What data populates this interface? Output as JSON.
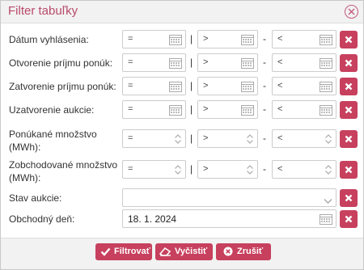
{
  "dialog": {
    "title": "Filter tabuľky",
    "close_icon": "close-circle-icon"
  },
  "rows": [
    {
      "label": "Dátum vyhlásenia:",
      "kind": "date-range",
      "op_eq": "=",
      "op_gt": ">",
      "op_lt": "<"
    },
    {
      "label": "Otvorenie príjmu ponúk:",
      "kind": "date-range",
      "op_eq": "=",
      "op_gt": ">",
      "op_lt": "<"
    },
    {
      "label": "Zatvorenie príjmu ponúk:",
      "kind": "date-range",
      "op_eq": "=",
      "op_gt": ">",
      "op_lt": "<"
    },
    {
      "label": "Uzatvorenie aukcie:",
      "kind": "date-range",
      "op_eq": "=",
      "op_gt": ">",
      "op_lt": "<"
    },
    {
      "label_line1": "Ponúkané množstvo",
      "label_line2": "(MWh):",
      "kind": "number-range",
      "op_eq": "=",
      "op_gt": ">",
      "op_lt": "<"
    },
    {
      "label_line1": "Zobchodované množstvo",
      "label_line2": "(MWh):",
      "kind": "number-range",
      "op_eq": "=",
      "op_gt": ">",
      "op_lt": "<"
    },
    {
      "label": "Stav aukcie:",
      "kind": "select",
      "value": ""
    },
    {
      "label": "Obchodný deň:",
      "kind": "date",
      "value": "18. 1. 2024"
    }
  ],
  "separators": {
    "pipe": "|",
    "dash": "-"
  },
  "footer": {
    "filter_label": "Filtrovať",
    "clear_label": "Vyčistiť",
    "cancel_label": "Zrušiť"
  },
  "colors": {
    "accent": "#c7405e",
    "title": "#b94a6c"
  }
}
